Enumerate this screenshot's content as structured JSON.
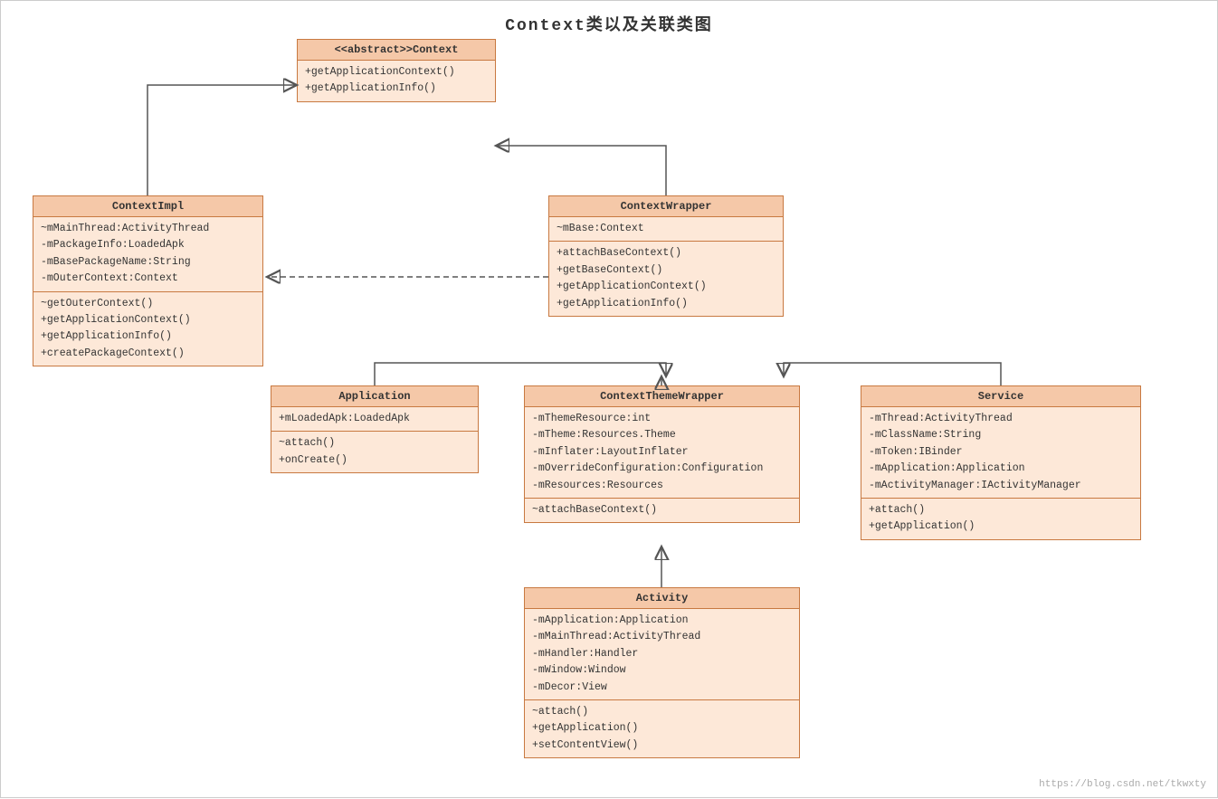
{
  "title": "Context类以及关联类图",
  "watermark": "https://blog.csdn.net/tkwxty",
  "boxes": {
    "context": {
      "header": "<<abstract>>Context",
      "section1": [
        "+getApplicationContext()",
        "+getApplicationInfo()"
      ],
      "section2": []
    },
    "contextImpl": {
      "header": "ContextImpl",
      "section1": [
        "~mMainThread:ActivityThread",
        "-mPackageInfo:LoadedApk",
        "-mBasePackageName:String",
        "-mOuterContext:Context"
      ],
      "section2": [
        "~getOuterContext()",
        "+getApplicationContext()",
        "+getApplicationInfo()",
        "+createPackageContext()"
      ]
    },
    "contextWrapper": {
      "header": "ContextWrapper",
      "section1": [
        "~mBase:Context"
      ],
      "section2": [
        "+attachBaseContext()",
        "+getBaseContext()",
        "+getApplicationContext()",
        "+getApplicationInfo()"
      ]
    },
    "application": {
      "header": "Application",
      "section1": [
        "+mLoadedApk:LoadedApk"
      ],
      "section2": [
        "~attach()",
        "+onCreate()"
      ]
    },
    "contextThemeWrapper": {
      "header": "ContextThemeWrapper",
      "section1": [
        "-mThemeResource:int",
        "-mTheme:Resources.Theme",
        "-mInflater:LayoutInflater",
        "-mOverrideConfiguration:Configuration",
        "-mResources:Resources"
      ],
      "section2": [
        "~attachBaseContext()"
      ]
    },
    "service": {
      "header": "Service",
      "section1": [
        "-mThread:ActivityThread",
        "-mClassName:String",
        "-mToken:IBinder",
        "-mApplication:Application",
        "-mActivityManager:IActivityManager"
      ],
      "section2": [
        "+attach()",
        "+getApplication()"
      ]
    },
    "activity": {
      "header": "Activity",
      "section1": [
        "-mApplication:Application",
        "-mMainThread:ActivityThread",
        "-mHandler:Handler",
        "-mWindow:Window",
        "-mDecor:View"
      ],
      "section2": [
        "~attach()",
        "+getApplication()",
        "+setContentView()"
      ]
    }
  }
}
